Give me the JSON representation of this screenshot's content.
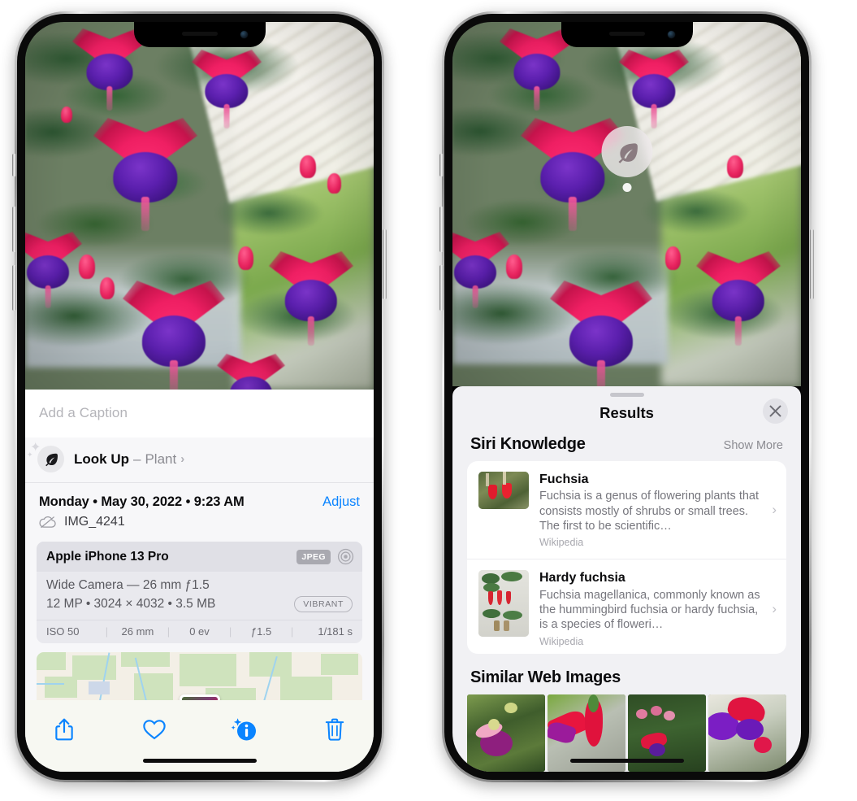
{
  "left_phone": {
    "name": "photo-detail-screen",
    "caption": {
      "placeholder": "Add a Caption",
      "value": ""
    },
    "lookup": {
      "icon": "leaf-icon",
      "sparkle_icon": "sparkle-icon",
      "label": "Look Up",
      "dash": "–",
      "subject": "Plant",
      "chevron": "›"
    },
    "meta": {
      "date": "Monday • May 30, 2022 • 9:23 AM",
      "adjust_label": "Adjust",
      "cloud_icon": "icloud-slash-icon",
      "filename": "IMG_4241"
    },
    "camera_card": {
      "model": "Apple iPhone 13 Pro",
      "format_badge": "JPEG",
      "hdr_icon": "aperture-icon",
      "lens": "Wide Camera — 26 mm ƒ1.5",
      "size": "12 MP • 3024 × 4032 • 3.5 MB",
      "style_badge": "VIBRANT",
      "exif": [
        "ISO 50",
        "26 mm",
        "0 ev",
        "ƒ1.5",
        "1/181 s"
      ],
      "exif_separator": "|"
    },
    "map": {
      "name": "location-map",
      "pin": "photo-thumbnail-pin"
    },
    "toolbar": [
      {
        "name": "share-button",
        "icon": "share-icon"
      },
      {
        "name": "favorite-button",
        "icon": "heart-icon"
      },
      {
        "name": "info-button",
        "icon": "info-sparkle-icon"
      },
      {
        "name": "delete-button",
        "icon": "trash-icon"
      }
    ],
    "accent_color": "#0a84ff"
  },
  "right_phone": {
    "name": "visual-lookup-results-screen",
    "photo_badge": {
      "icon": "leaf-icon",
      "name": "visual-lookup-badge"
    },
    "sheet": {
      "title": "Results",
      "close_icon": "close-icon",
      "sections": [
        {
          "title": "Siri Knowledge",
          "action": "Show More",
          "items": [
            {
              "title": "Fuchsia",
              "description": "Fuchsia is a genus of flowering plants that consists mostly of shrubs or small trees. The first to be scientific…",
              "source": "Wikipedia",
              "chevron": "›"
            },
            {
              "title": "Hardy fuchsia",
              "description": "Fuchsia magellanica, commonly known as the hummingbird fuchsia or hardy fuchsia, is a species of floweri…",
              "source": "Wikipedia",
              "chevron": "›"
            }
          ]
        },
        {
          "title": "Similar Web Images",
          "thumbnails": [
            {
              "name": "similar-image-1"
            },
            {
              "name": "similar-image-2"
            },
            {
              "name": "similar-image-3"
            },
            {
              "name": "similar-image-4"
            }
          ]
        }
      ]
    }
  }
}
